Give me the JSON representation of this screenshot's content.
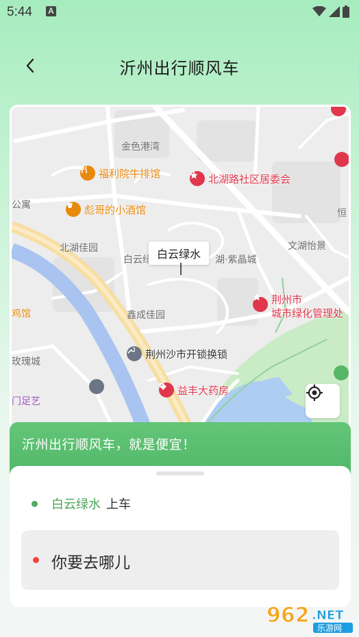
{
  "status_bar": {
    "time": "5:44",
    "notification_letter": "A"
  },
  "header": {
    "title": "沂州出行顺风车"
  },
  "map": {
    "pin_label": "白云绿水",
    "pois": [
      {
        "label": "福利院牛排馆",
        "color": "#e8890c",
        "icon": "food-icon"
      },
      {
        "label": "彪哥的小酒馆",
        "color": "#e8890c",
        "icon": "drink-icon"
      },
      {
        "label": "北湖路社区居委会",
        "color": "#e0374c",
        "icon": "star-icon"
      },
      {
        "label": "荆州市城市绿化管理处",
        "line1": "荆州市",
        "line2": "城市绿化管理处",
        "color": "#e0374c",
        "icon": "star-icon"
      },
      {
        "label": "荆州沙市开锁换锁",
        "color": "#3b3b3b",
        "icon": "wrench-icon"
      },
      {
        "label": "益丰大药房",
        "color": "#e0374c",
        "icon": "tag-icon"
      }
    ],
    "area_labels": {
      "a1": "金色港湾",
      "a2": "公寓",
      "a3": "北湖佳园",
      "a4": "白云绿",
      "a5": "湖·紫晶城",
      "a6": "文湖怡景",
      "a7": "恒",
      "a8": "鸡馆",
      "a9": "鑫成佳园",
      "a10": "玫瑰城",
      "a11": "门足艺"
    }
  },
  "promo": {
    "text": "沂州出行顺风车，就是便宜！"
  },
  "trip": {
    "pickup_place": "白云绿水",
    "pickup_suffix": "上车",
    "destination_placeholder": "你要去哪儿"
  },
  "watermark": {
    "number": "962",
    "domain": ".NET",
    "site": "乐游网"
  },
  "colors": {
    "accent_green": "#55b96a",
    "pickup_green": "#4fa35e",
    "destination_red": "#f2443f"
  }
}
